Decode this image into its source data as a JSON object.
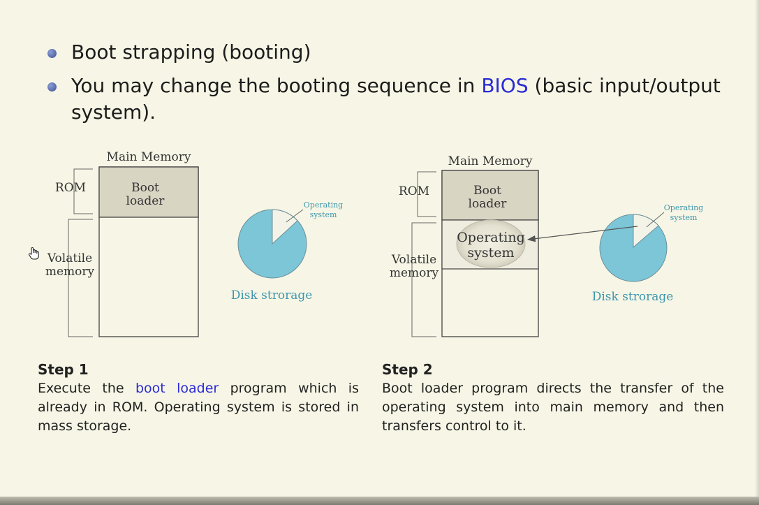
{
  "bullets": [
    {
      "text": "Boot strapping (booting)"
    },
    {
      "pre": "You may change the booting sequence in ",
      "highlight": "BIOS",
      "post": " (basic input/output system)."
    }
  ],
  "diagram1": {
    "memory_title": "Main Memory",
    "rom_label": "ROM",
    "boot_loader_line1": "Boot",
    "boot_loader_line2": "loader",
    "volatile_line1": "Volatile",
    "volatile_line2": "memory",
    "os_line1": "Operating",
    "os_line2": "system",
    "disk_label": "Disk strorage"
  },
  "diagram2": {
    "memory_title": "Main Memory",
    "rom_label": "ROM",
    "boot_loader_line1": "Boot",
    "boot_loader_line2": "loader",
    "volatile_line1": "Volatile",
    "volatile_line2": "memory",
    "os_in_memory_line1": "Operating",
    "os_in_memory_line2": "system",
    "os_line1": "Operating",
    "os_line2": "system",
    "disk_label": "Disk strorage"
  },
  "step1": {
    "title": "Step 1",
    "pre": "Execute the ",
    "highlight": "boot loader",
    "post": " program which is already in ROM. Operating system is stored in mass storage."
  },
  "step2": {
    "title": "Step 2",
    "text": "Boot loader program directs the transfer of the operating system into main memory and then transfers control to it."
  },
  "colors": {
    "background": "#f7f6e6",
    "highlight": "#2a2ad6",
    "disk": "#7cc6d8",
    "rom_fill": "#d9d5c3"
  },
  "icons": {
    "cursor": "hand-cursor-icon"
  }
}
